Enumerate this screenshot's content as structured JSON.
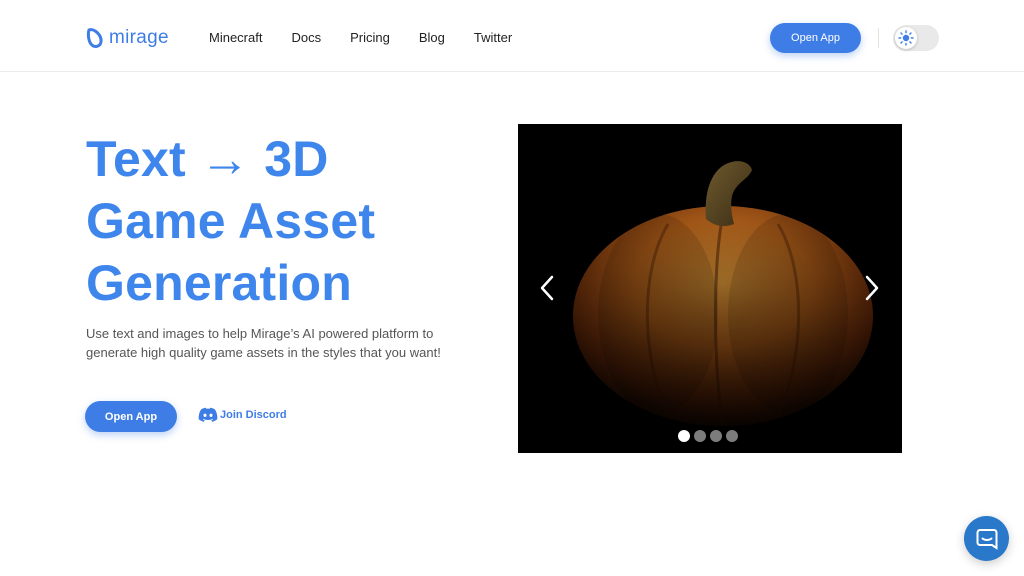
{
  "brand": {
    "name": "mirage",
    "color": "#3f7de6"
  },
  "nav": {
    "items": [
      {
        "label": "Minecraft"
      },
      {
        "label": "Docs"
      },
      {
        "label": "Pricing"
      },
      {
        "label": "Blog"
      },
      {
        "label": "Twitter"
      }
    ]
  },
  "header": {
    "open_app_label": "Open App",
    "theme_toggle_icon": "sun-icon"
  },
  "hero": {
    "title_lines": [
      "Text → 3D",
      "Game Asset",
      "Generation"
    ],
    "description": "Use text and images to help Mirage’s AI powered platform to generate high quality game assets in the styles that you want!",
    "primary_button": "Open App",
    "discord_link": "Join Discord"
  },
  "carousel": {
    "slide_count": 4,
    "active_index": 0,
    "current_slide_subject": "pumpkin",
    "prev_icon": "chevron-left-icon",
    "next_icon": "chevron-right-icon"
  },
  "chat": {
    "icon": "chat-bubble-icon",
    "color": "#2a78c9"
  },
  "colors": {
    "accent": "#3f7de6",
    "title": "#3f86ec",
    "carousel_bg": "#000000"
  }
}
